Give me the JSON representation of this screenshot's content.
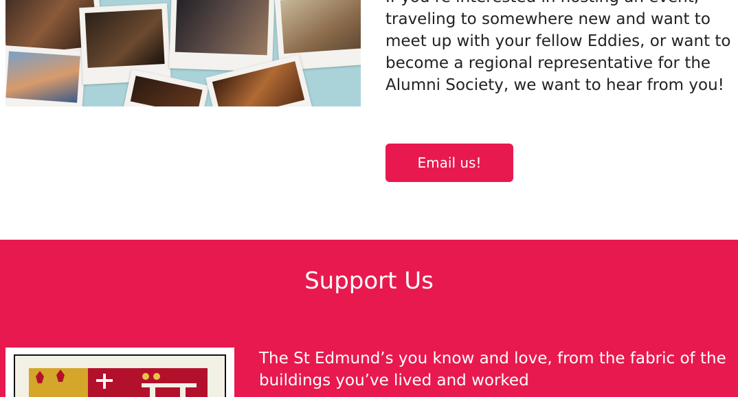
{
  "intro": {
    "paragraph": "If you’re interested in hosting an event, traveling to somewhere new and want to meet up with your fellow Eddies, or want to become a regional representative for the Alumni Society, we want to hear from you!",
    "email_button_label": "Email us!"
  },
  "support": {
    "title": "Support Us",
    "paragraph": "The St Edmund’s you know and love, from the fabric of the buildings you’ve lived and worked"
  },
  "colors": {
    "accent": "#e8194f",
    "text": "#222222",
    "white": "#ffffff"
  }
}
